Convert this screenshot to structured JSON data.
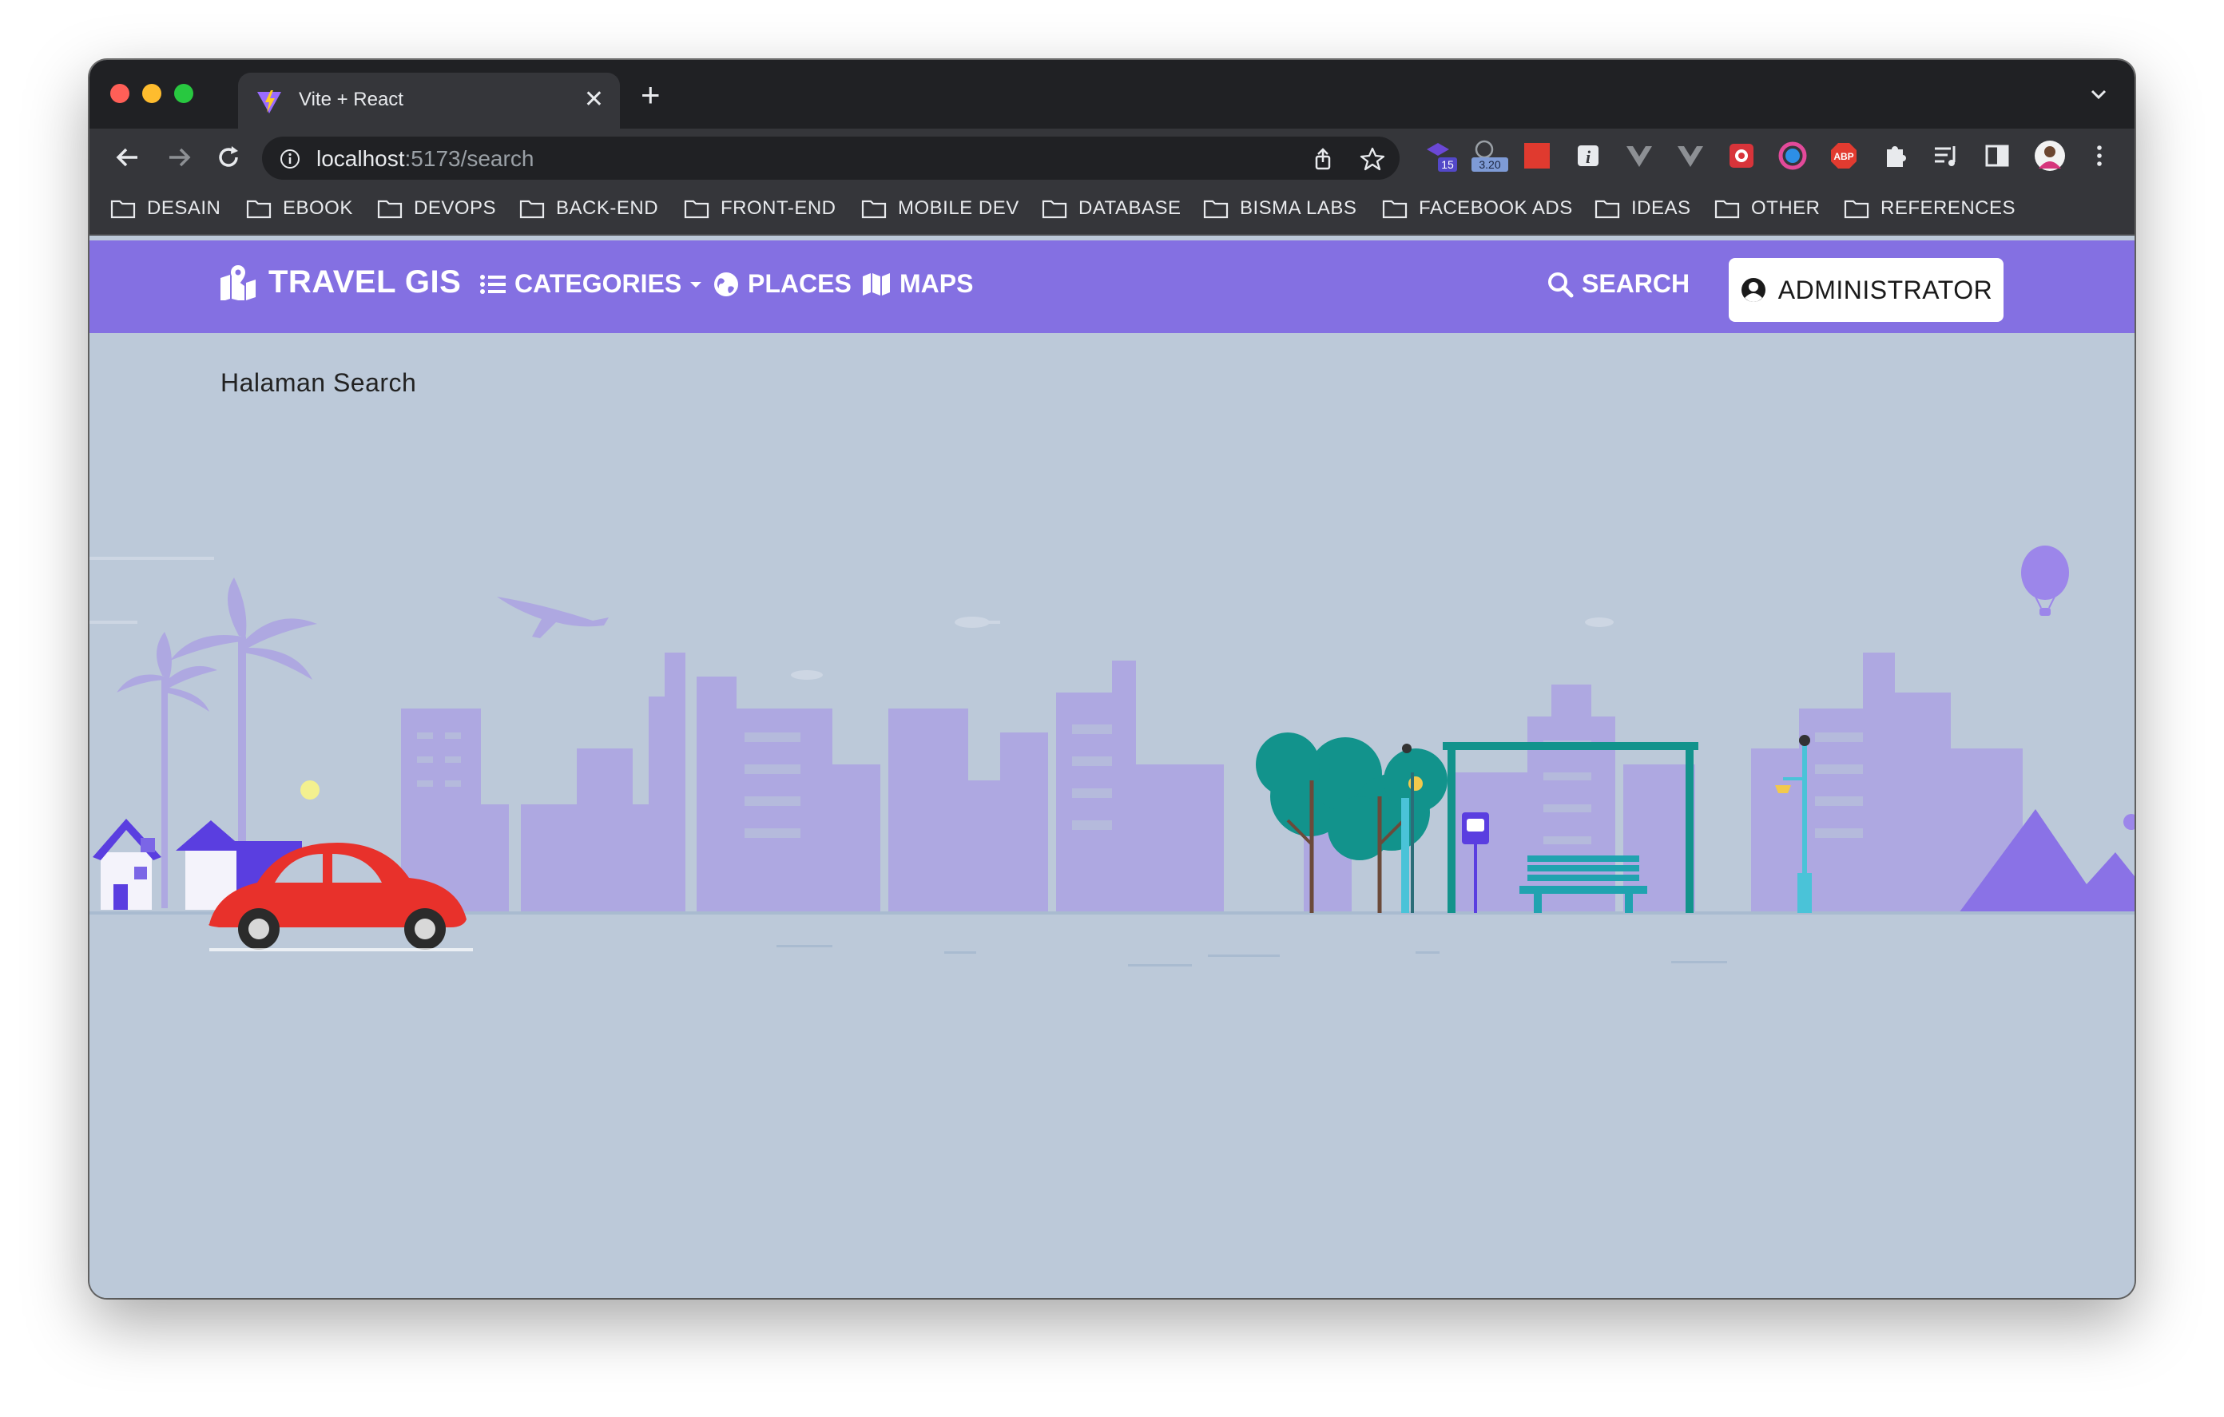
{
  "browser": {
    "tab": {
      "title": "Vite + React",
      "close_symbol": "✕"
    },
    "new_tab_symbol": "+",
    "address": {
      "host": "localhost",
      "path": ":5173/search"
    },
    "extensions": [
      {
        "name": "graduation-cap-extension-icon",
        "badge": "15"
      },
      {
        "name": "timer-extension-icon",
        "badge": "3.20"
      },
      {
        "name": "red-square-extension-icon"
      },
      {
        "name": "info-extension-icon"
      },
      {
        "name": "vue-devtools-icon"
      },
      {
        "name": "vue-devtools-icon"
      },
      {
        "name": "cyclops-extension-icon"
      },
      {
        "name": "color-picker-extension-icon"
      },
      {
        "name": "adblock-plus-icon",
        "label": "ABP"
      },
      {
        "name": "puzzle-extensions-icon"
      },
      {
        "name": "reading-list-icon"
      },
      {
        "name": "sidebar-toggle-icon"
      },
      {
        "name": "profile-avatar"
      },
      {
        "name": "kebab-menu-icon"
      }
    ],
    "bookmarks": [
      "DESAIN",
      "EBOOK",
      "DEVOPS",
      "BACK-END",
      "FRONT-END",
      "MOBILE DEV",
      "DATABASE",
      "BISMA LABS",
      "FACEBOOK ADS",
      "IDEAS",
      "OTHER",
      "REFERENCES"
    ]
  },
  "app": {
    "brand": "TRAVEL GIS",
    "nav": {
      "categories": "CATEGORIES",
      "places": "PLACES",
      "maps": "MAPS",
      "search": "SEARCH"
    },
    "admin_button": "ADMINISTRATOR",
    "page_text": "Halaman Search"
  },
  "colors": {
    "navbar": "#8470e2",
    "page_background": "#bcc9d9",
    "skyline": "#ada9e2",
    "car": "#e8312b",
    "teal": "#12938c"
  }
}
